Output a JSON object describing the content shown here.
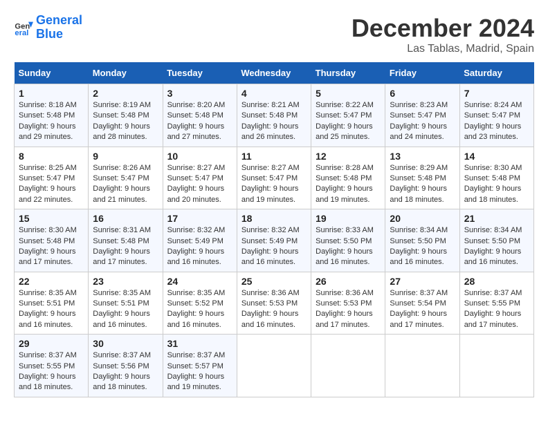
{
  "logo": {
    "text_general": "General",
    "text_blue": "Blue"
  },
  "title": "December 2024",
  "location": "Las Tablas, Madrid, Spain",
  "days_header": [
    "Sunday",
    "Monday",
    "Tuesday",
    "Wednesday",
    "Thursday",
    "Friday",
    "Saturday"
  ],
  "weeks": [
    [
      {
        "day": "1",
        "sunrise": "8:18 AM",
        "sunset": "5:48 PM",
        "daylight": "9 hours and 29 minutes."
      },
      {
        "day": "2",
        "sunrise": "8:19 AM",
        "sunset": "5:48 PM",
        "daylight": "9 hours and 28 minutes."
      },
      {
        "day": "3",
        "sunrise": "8:20 AM",
        "sunset": "5:48 PM",
        "daylight": "9 hours and 27 minutes."
      },
      {
        "day": "4",
        "sunrise": "8:21 AM",
        "sunset": "5:48 PM",
        "daylight": "9 hours and 26 minutes."
      },
      {
        "day": "5",
        "sunrise": "8:22 AM",
        "sunset": "5:47 PM",
        "daylight": "9 hours and 25 minutes."
      },
      {
        "day": "6",
        "sunrise": "8:23 AM",
        "sunset": "5:47 PM",
        "daylight": "9 hours and 24 minutes."
      },
      {
        "day": "7",
        "sunrise": "8:24 AM",
        "sunset": "5:47 PM",
        "daylight": "9 hours and 23 minutes."
      }
    ],
    [
      {
        "day": "8",
        "sunrise": "8:25 AM",
        "sunset": "5:47 PM",
        "daylight": "9 hours and 22 minutes."
      },
      {
        "day": "9",
        "sunrise": "8:26 AM",
        "sunset": "5:47 PM",
        "daylight": "9 hours and 21 minutes."
      },
      {
        "day": "10",
        "sunrise": "8:27 AM",
        "sunset": "5:47 PM",
        "daylight": "9 hours and 20 minutes."
      },
      {
        "day": "11",
        "sunrise": "8:27 AM",
        "sunset": "5:47 PM",
        "daylight": "9 hours and 19 minutes."
      },
      {
        "day": "12",
        "sunrise": "8:28 AM",
        "sunset": "5:48 PM",
        "daylight": "9 hours and 19 minutes."
      },
      {
        "day": "13",
        "sunrise": "8:29 AM",
        "sunset": "5:48 PM",
        "daylight": "9 hours and 18 minutes."
      },
      {
        "day": "14",
        "sunrise": "8:30 AM",
        "sunset": "5:48 PM",
        "daylight": "9 hours and 18 minutes."
      }
    ],
    [
      {
        "day": "15",
        "sunrise": "8:30 AM",
        "sunset": "5:48 PM",
        "daylight": "9 hours and 17 minutes."
      },
      {
        "day": "16",
        "sunrise": "8:31 AM",
        "sunset": "5:48 PM",
        "daylight": "9 hours and 17 minutes."
      },
      {
        "day": "17",
        "sunrise": "8:32 AM",
        "sunset": "5:49 PM",
        "daylight": "9 hours and 16 minutes."
      },
      {
        "day": "18",
        "sunrise": "8:32 AM",
        "sunset": "5:49 PM",
        "daylight": "9 hours and 16 minutes."
      },
      {
        "day": "19",
        "sunrise": "8:33 AM",
        "sunset": "5:50 PM",
        "daylight": "9 hours and 16 minutes."
      },
      {
        "day": "20",
        "sunrise": "8:34 AM",
        "sunset": "5:50 PM",
        "daylight": "9 hours and 16 minutes."
      },
      {
        "day": "21",
        "sunrise": "8:34 AM",
        "sunset": "5:50 PM",
        "daylight": "9 hours and 16 minutes."
      }
    ],
    [
      {
        "day": "22",
        "sunrise": "8:35 AM",
        "sunset": "5:51 PM",
        "daylight": "9 hours and 16 minutes."
      },
      {
        "day": "23",
        "sunrise": "8:35 AM",
        "sunset": "5:51 PM",
        "daylight": "9 hours and 16 minutes."
      },
      {
        "day": "24",
        "sunrise": "8:35 AM",
        "sunset": "5:52 PM",
        "daylight": "9 hours and 16 minutes."
      },
      {
        "day": "25",
        "sunrise": "8:36 AM",
        "sunset": "5:53 PM",
        "daylight": "9 hours and 16 minutes."
      },
      {
        "day": "26",
        "sunrise": "8:36 AM",
        "sunset": "5:53 PM",
        "daylight": "9 hours and 17 minutes."
      },
      {
        "day": "27",
        "sunrise": "8:37 AM",
        "sunset": "5:54 PM",
        "daylight": "9 hours and 17 minutes."
      },
      {
        "day": "28",
        "sunrise": "8:37 AM",
        "sunset": "5:55 PM",
        "daylight": "9 hours and 17 minutes."
      }
    ],
    [
      {
        "day": "29",
        "sunrise": "8:37 AM",
        "sunset": "5:55 PM",
        "daylight": "9 hours and 18 minutes."
      },
      {
        "day": "30",
        "sunrise": "8:37 AM",
        "sunset": "5:56 PM",
        "daylight": "9 hours and 18 minutes."
      },
      {
        "day": "31",
        "sunrise": "8:37 AM",
        "sunset": "5:57 PM",
        "daylight": "9 hours and 19 minutes."
      },
      null,
      null,
      null,
      null
    ]
  ]
}
